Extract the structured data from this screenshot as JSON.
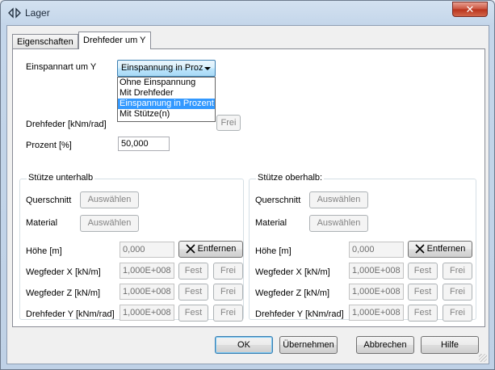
{
  "window": {
    "title": "Lager",
    "close_glyph": "✕"
  },
  "tabs": [
    {
      "label": "Eigenschaften"
    },
    {
      "label": "Drehfeder um Y"
    }
  ],
  "clamp": {
    "label": "Einspannart um Y",
    "selected": "Einspannung in Proz",
    "options": [
      "Ohne Einspannung",
      "Mit Drehfeder",
      "Einspannung in Prozent",
      "Mit Stütze(n)"
    ],
    "selected_option_index": 2
  },
  "spring": {
    "label": "Drehfeder [kNm/rad]",
    "frei": "Frei"
  },
  "percent": {
    "label": "Prozent [%]",
    "value": "50,000"
  },
  "lower": {
    "title": "Stütze unterhalb",
    "querschnitt": "Querschnitt",
    "material": "Material",
    "select": "Auswählen",
    "hoehe": "Höhe [m]",
    "hoehe_value": "0,000",
    "entfernen": "Entfernen",
    "wx": "Wegfeder X [kN/m]",
    "wx_value": "1,000E+008",
    "wz": "Wegfeder Z [kN/m]",
    "wz_value": "1,000E+008",
    "dy": "Drehfeder Y [kNm/rad]",
    "dy_value": "1,000E+008",
    "fest": "Fest",
    "frei": "Frei"
  },
  "upper": {
    "title": "Stütze oberhalb:",
    "querschnitt": "Querschnitt",
    "material": "Material",
    "select": "Auswählen",
    "hoehe": "Höhe [m]",
    "hoehe_value": "0,000",
    "entfernen": "Entfernen",
    "wx": "Wegfeder X [kN/m]",
    "wx_value": "1,000E+008",
    "wz": "Wegfeder Z [kN/m]",
    "wz_value": "1,000E+008",
    "dy": "Drehfeder Y [kNm/rad]",
    "dy_value": "1,000E+008",
    "fest": "Fest",
    "frei": "Frei"
  },
  "buttons": {
    "ok": "OK",
    "apply": "Übernehmen",
    "cancel": "Abbrechen",
    "help": "Hilfe"
  }
}
